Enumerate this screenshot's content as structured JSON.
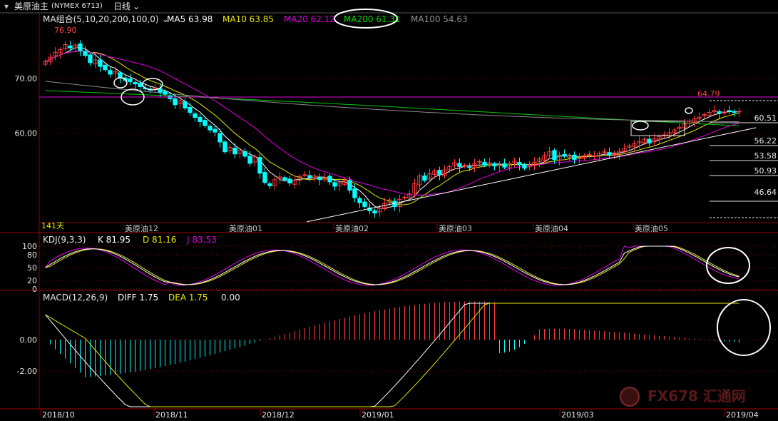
{
  "header": {
    "instrument": "美原油主",
    "code": "(NYMEX 6713)",
    "period": "日线"
  },
  "panels": {
    "main": {
      "ma_title": "MA组合(5,10,20,200,100,0)",
      "legend": [
        {
          "label": "MA5 63.98",
          "color": "#ffffff"
        },
        {
          "label": "MA10 63.85",
          "color": "#e8e800"
        },
        {
          "label": "MA20 62.12",
          "color": "#e000e0"
        },
        {
          "label": "MA200 61.31",
          "color": "#00e000"
        },
        {
          "label": "MA100 54.63",
          "color": "#909090"
        }
      ],
      "high_label": "76.90",
      "recent_high_label": "64.79",
      "price_axis": [
        "70.00",
        "60.00"
      ],
      "right_levels": [
        "60.51",
        "56.22",
        "53.58",
        "50.93",
        "46.64"
      ],
      "bars_label": "141天",
      "contract_labels": [
        "美原油12",
        "美原油01",
        "美原油02",
        "美原油03",
        "美原油04",
        "美原油05"
      ]
    },
    "kdj": {
      "title": "KDJ(9,3,3)",
      "legend": [
        {
          "label": "K 81.95",
          "color": "#ffffff"
        },
        {
          "label": "D 81.16",
          "color": "#e8e800"
        },
        {
          "label": "J 83.53",
          "color": "#e000e0"
        }
      ],
      "axis": [
        "100",
        "80",
        "50",
        "20",
        "0"
      ]
    },
    "macd": {
      "title": "MACD(12,26,9)",
      "legend": [
        {
          "label": "DIFF 1.75",
          "color": "#ffffff"
        },
        {
          "label": "DEA 1.75",
          "color": "#e8e800"
        },
        {
          "label": "0.00",
          "color": "#e6e6e6"
        }
      ],
      "axis": [
        "0.00",
        "-2.00"
      ]
    }
  },
  "date_axis": [
    "2018/10",
    "2018/11",
    "2018/12",
    "2019/01",
    "2019/03",
    "2019/04"
  ],
  "watermark": "FX678 汇通网",
  "colors": {
    "up": "#ff3a3a",
    "down": "#00ffff",
    "grid": "#8a0000",
    "axis_text": "#e6e6e6",
    "high_label": "#ff4040"
  },
  "chart_data": {
    "type": "candlestick",
    "title": "美原油主 (NYMEX 6713) 日线",
    "ylim": [
      43,
      79
    ],
    "close": [
      73.1,
      73.9,
      74.8,
      75.3,
      76.2,
      75.6,
      76.1,
      75.1,
      74.2,
      72.9,
      73.4,
      72.2,
      71.6,
      70.8,
      71.3,
      70.1,
      69.7,
      69.4,
      69.0,
      68.5,
      68.1,
      67.9,
      68.3,
      67.5,
      67.1,
      66.3,
      65.2,
      65.9,
      64.6,
      63.8,
      62.9,
      62.1,
      61.4,
      60.6,
      60.2,
      58.4,
      56.6,
      57.4,
      56.2,
      56.9,
      55.8,
      54.5,
      55.7,
      52.7,
      51.0,
      50.4,
      51.5,
      52.0,
      51.5,
      50.9,
      51.4,
      52.1,
      52.4,
      51.8,
      52.2,
      51.5,
      51.9,
      51.1,
      50.3,
      50.9,
      51.4,
      49.6,
      48.2,
      47.3,
      46.6,
      45.8,
      45.4,
      46.3,
      47.2,
      47.8,
      46.6,
      47.9,
      48.3,
      48.9,
      50.8,
      52.2,
      51.4,
      52.6,
      53.1,
      52.4,
      53.3,
      53.9,
      54.6,
      53.9,
      54.1,
      53.7,
      54.4,
      54.8,
      54.2,
      54.6,
      54.0,
      54.2,
      53.8,
      54.5,
      54.9,
      54.2,
      53.6,
      54.2,
      54.7,
      55.3,
      55.9,
      56.6,
      55.2,
      56.0,
      55.8,
      56.0,
      55.2,
      55.5,
      55.9,
      56.1,
      55.9,
      56.3,
      56.6,
      56.0,
      56.4,
      56.7,
      57.2,
      57.7,
      58.1,
      58.5,
      58.9,
      58.2,
      59.0,
      59.4,
      59.7,
      60.1,
      60.6,
      61.1,
      61.7,
      62.2,
      62.6,
      62.9,
      63.4,
      63.8,
      64.2,
      63.7,
      63.9,
      64.1,
      63.8,
      64.0
    ]
  }
}
